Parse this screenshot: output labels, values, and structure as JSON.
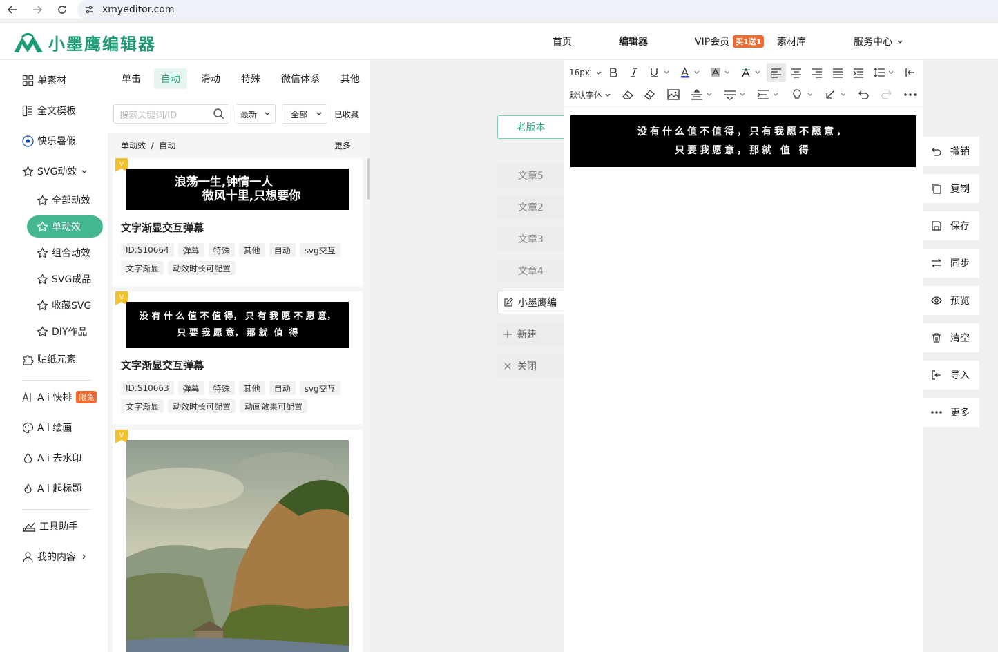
{
  "browser": {
    "url": "xmyeditor.com"
  },
  "header": {
    "logo_text": "小墨鹰编辑器",
    "nav": [
      {
        "label": "首页"
      },
      {
        "label": "编辑器"
      },
      {
        "label": "VIP会员",
        "badge": "买1送1"
      },
      {
        "label": "素材库"
      },
      {
        "label": "服务中心"
      }
    ]
  },
  "sidebar": {
    "items": [
      {
        "label": "单素材"
      },
      {
        "label": "全文模板"
      },
      {
        "label": "快乐暑假"
      },
      {
        "label": "SVG动效"
      },
      {
        "label": "全部动效"
      },
      {
        "label": "单动效"
      },
      {
        "label": "组合动效"
      },
      {
        "label": "SVG成品"
      },
      {
        "label": "收藏SVG"
      },
      {
        "label": "DIY作品"
      },
      {
        "label": "贴纸元素"
      },
      {
        "label": "A i 快排",
        "badge": "限免"
      },
      {
        "label": "A i 绘画"
      },
      {
        "label": "A i 去水印"
      },
      {
        "label": "A i 起标题"
      },
      {
        "label": "工具助手"
      },
      {
        "label": "我的内容"
      }
    ]
  },
  "panel": {
    "tabs": [
      "单击",
      "自动",
      "滑动",
      "特殊",
      "微信体系",
      "其他"
    ],
    "active_tab": "自动",
    "search_placeholder": "搜索关键词/ID",
    "sort_select": "最新",
    "filter_select": "全部",
    "collected_label": "已收藏",
    "breadcrumb": "单动效  /  自动",
    "more_label": "更多",
    "cards": [
      {
        "preview_lines": [
          "浪荡一生,钟情一人",
          "微风十里,只想要你"
        ],
        "title": "文字渐显交互弹幕",
        "tags": [
          "ID:S10664",
          "弹幕",
          "特殊",
          "其他",
          "自动",
          "svg交互",
          "文字渐显",
          "动效时长可配置"
        ]
      },
      {
        "preview_lines": [
          "没 有 什 么 值 不 值 得， 只 有 我 愿 不 愿 意，",
          "只 要 我 愿 意， 那 就  值  得"
        ],
        "title": "文字渐显交互弹幕",
        "tags": [
          "ID:S10663",
          "弹幕",
          "特殊",
          "其他",
          "自动",
          "svg交互",
          "文字渐显",
          "动效时长可配置",
          "动画效果可配置"
        ]
      }
    ]
  },
  "articles": {
    "old_version": "老版本",
    "tabs": [
      "文章5",
      "文章2",
      "文章3",
      "文章4"
    ],
    "current": "小墨鹰编",
    "new_label": "新建",
    "close_label": "关闭"
  },
  "editor": {
    "font_size": "16px",
    "font_family": "默认字体",
    "content_lines": [
      "没有什么值不值得，只有我愿不愿意，",
      "只要我愿意，那就 值 得"
    ]
  },
  "actions": [
    "撤销",
    "复制",
    "保存",
    "同步",
    "预览",
    "清空",
    "导入",
    "更多"
  ],
  "colors": {
    "brand": "#1e9b74",
    "accent": "#45b78e",
    "badge": "#f26a2e"
  }
}
